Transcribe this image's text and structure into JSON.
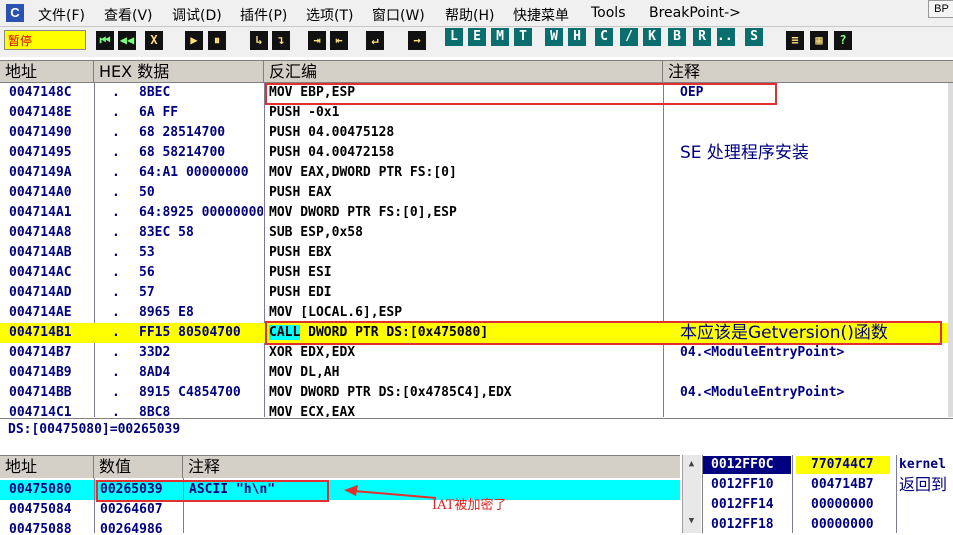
{
  "menubar": {
    "app_icon": "C",
    "items": [
      "文件(F)",
      "查看(V)",
      "调试(D)",
      "插件(P)",
      "选项(T)",
      "窗口(W)",
      "帮助(H)",
      "快捷菜单",
      "Tools",
      "BreakPoint->"
    ],
    "corner_button": "BP"
  },
  "toolbar": {
    "status": "暂停",
    "buttons_group1": [
      "⏮",
      "◀◀",
      "X",
      "▶",
      "⏸",
      "↳",
      "↴",
      "⇥",
      "⇤",
      "↵",
      "→"
    ],
    "buttons_group2": [
      "L",
      "E",
      "M",
      "T",
      "W",
      "H",
      "C",
      "/",
      "K",
      "B",
      "R",
      "...",
      "S"
    ],
    "buttons_group3": [
      "≡",
      "▦",
      "?"
    ]
  },
  "cpu": {
    "headers": [
      "地址",
      "HEX 数据",
      "反汇编",
      "注释"
    ],
    "rows": [
      {
        "addr": "0047148C",
        "dot": ".",
        "hex": "8BEC",
        "dis": "MOV EBP,ESP",
        "cmt": "OEP"
      },
      {
        "addr": "0047148E",
        "dot": ".",
        "hex": "6A FF",
        "dis": "PUSH -0x1",
        "cmt": ""
      },
      {
        "addr": "00471490",
        "dot": ".",
        "hex": "68 28514700",
        "dis": "PUSH 04.00475128",
        "cmt": ""
      },
      {
        "addr": "00471495",
        "dot": ".",
        "hex": "68 58214700",
        "dis": "PUSH 04.00472158",
        "cmt": "SE 处理程序安装"
      },
      {
        "addr": "0047149A",
        "dot": ".",
        "hex": "64:A1 00000000",
        "dis": "MOV EAX,DWORD PTR FS:[0]",
        "cmt": ""
      },
      {
        "addr": "004714A0",
        "dot": ".",
        "hex": "50",
        "dis": "PUSH EAX",
        "cmt": ""
      },
      {
        "addr": "004714A1",
        "dot": ".",
        "hex": "64:8925 00000000",
        "dis": "MOV DWORD PTR FS:[0],ESP",
        "cmt": ""
      },
      {
        "addr": "004714A8",
        "dot": ".",
        "hex": "83EC 58",
        "dis": "SUB ESP,0x58",
        "cmt": ""
      },
      {
        "addr": "004714AB",
        "dot": ".",
        "hex": "53",
        "dis": "PUSH EBX",
        "cmt": ""
      },
      {
        "addr": "004714AC",
        "dot": ".",
        "hex": "56",
        "dis": "PUSH ESI",
        "cmt": ""
      },
      {
        "addr": "004714AD",
        "dot": ".",
        "hex": "57",
        "dis": "PUSH EDI",
        "cmt": ""
      },
      {
        "addr": "004714AE",
        "dot": ".",
        "hex": "8965 E8",
        "dis": "MOV [LOCAL.6],ESP",
        "cmt": ""
      },
      {
        "addr": "004714B1",
        "dot": ".",
        "hex": "FF15 80504700",
        "dis_op": "CALL",
        "dis": " DWORD PTR DS:[0x475080]",
        "cmt": "本应该是Getversion()函数",
        "selected": true
      },
      {
        "addr": "004714B7",
        "dot": ".",
        "hex": "33D2",
        "dis": "XOR EDX,EDX",
        "cmt": "04.<ModuleEntryPoint>"
      },
      {
        "addr": "004714B9",
        "dot": ".",
        "hex": "8AD4",
        "dis": "MOV DL,AH",
        "cmt": ""
      },
      {
        "addr": "004714BB",
        "dot": ".",
        "hex": "8915 C4854700",
        "dis": "MOV DWORD PTR DS:[0x4785C4],EDX",
        "cmt": "04.<ModuleEntryPoint>"
      },
      {
        "addr": "004714C1",
        "dot": ".",
        "hex": "8BC8",
        "dis": "MOV ECX,EAX",
        "cmt": ""
      }
    ]
  },
  "info_line": "DS:[00475080]=00265039",
  "dump": {
    "headers": [
      "地址",
      "数值",
      "注释"
    ],
    "rows": [
      {
        "addr": "00475080",
        "value": "00265039",
        "cmt": "ASCII \"h\\n\"",
        "selected": true
      },
      {
        "addr": "00475084",
        "value": "00264607",
        "cmt": ""
      },
      {
        "addr": "00475088",
        "value": "00264986",
        "cmt": ""
      }
    ]
  },
  "stack": {
    "rows": [
      {
        "addr": "0012FF0C",
        "value": "770744C7",
        "cmt": "kernel",
        "selected": true
      },
      {
        "addr": "0012FF10",
        "value": "004714B7",
        "cmt": "返回到"
      },
      {
        "addr": "0012FF14",
        "value": "00000000",
        "cmt": ""
      },
      {
        "addr": "0012FF18",
        "value": "00000000",
        "cmt": ""
      }
    ]
  },
  "annotation": {
    "iat_label": "IAT被加密了"
  },
  "colors": {
    "selected_row": "#ffff00",
    "dump_selected": "#00ffff",
    "annotation_red": "#e03030",
    "text_navy": "#000080"
  }
}
